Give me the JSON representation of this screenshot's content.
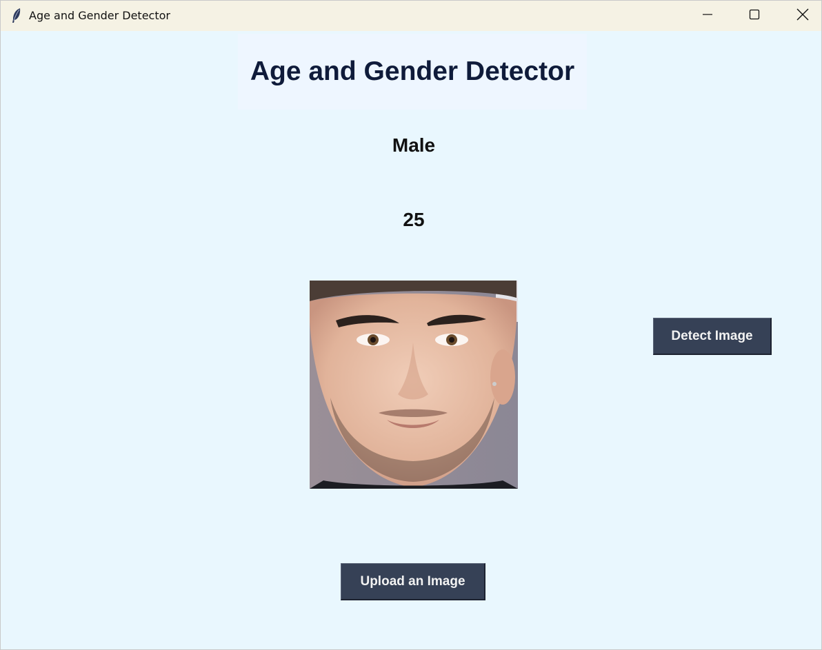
{
  "window": {
    "title": "Age and Gender Detector",
    "minimize_icon": "minimize-icon",
    "maximize_icon": "maximize-icon",
    "close_icon": "close-icon",
    "app_icon": "feather-icon"
  },
  "main": {
    "heading": "Age and Gender Detector",
    "gender": "Male",
    "age": "25",
    "face_image": "face-photo"
  },
  "buttons": {
    "detect_label": "Detect Image",
    "upload_label": "Upload an Image"
  },
  "colors": {
    "background": "#E9F7FE",
    "titlebar": "#F5F2E4",
    "heading_bg": "#EEF6FF",
    "heading_text": "#0F1B3A",
    "button_bg": "#364156",
    "button_text": "#F2F2F2"
  }
}
